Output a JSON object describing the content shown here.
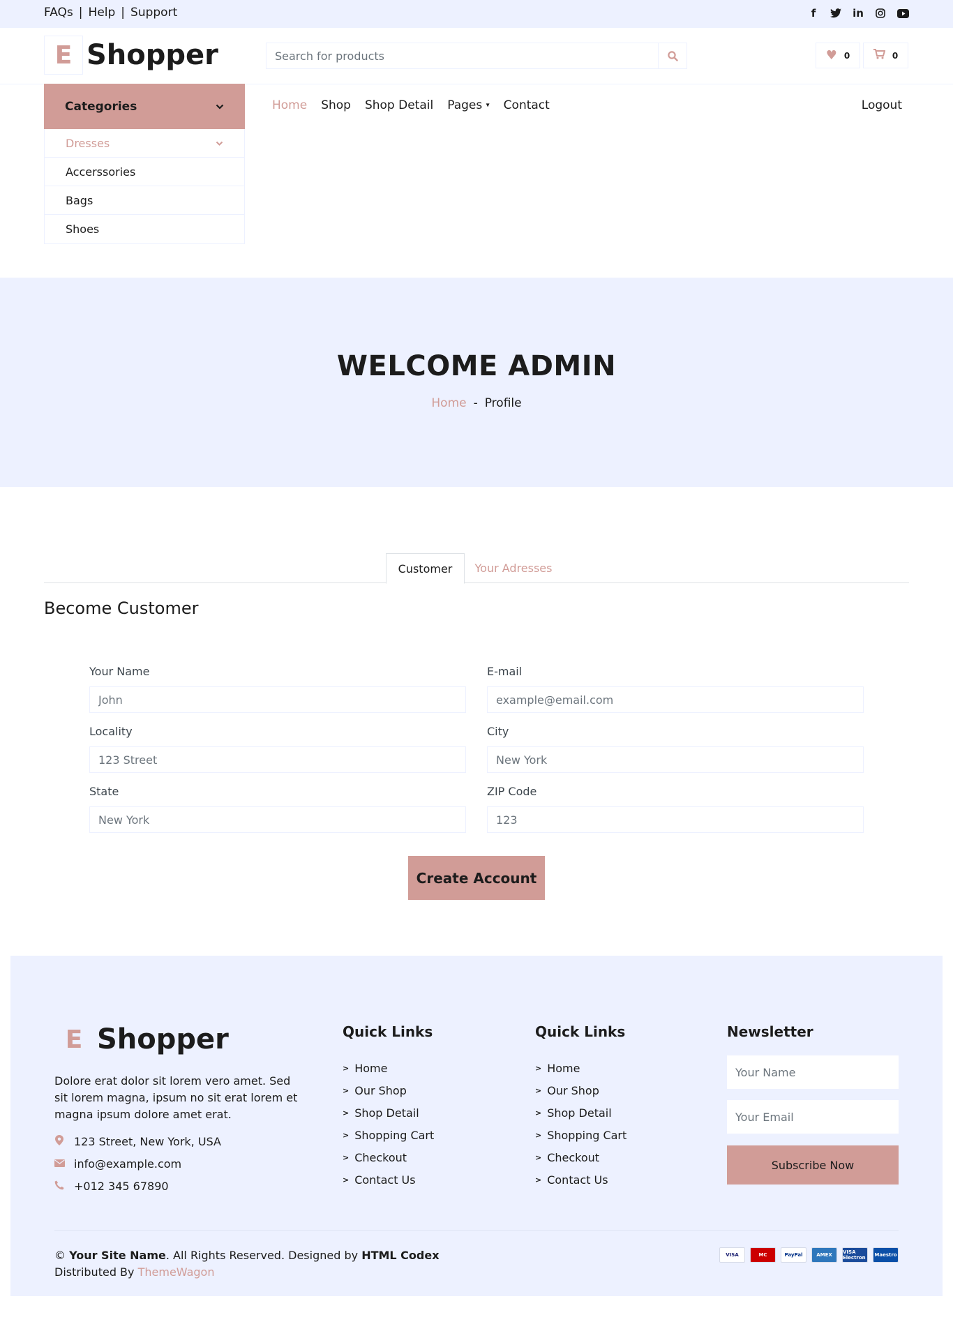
{
  "topbar": {
    "links": [
      "FAQs",
      "Help",
      "Support"
    ],
    "separator": "|",
    "socials": [
      "facebook-icon",
      "twitter-icon",
      "linkedin-icon",
      "instagram-icon",
      "youtube-icon"
    ]
  },
  "brand": {
    "letter": "E",
    "name": "Shopper"
  },
  "search": {
    "placeholder": "Search for products",
    "icon": "search-icon"
  },
  "header_buttons": {
    "wishlist_count": "0",
    "cart_count": "0"
  },
  "categories": {
    "title": "Categories",
    "items": [
      "Dresses",
      "Accerssories",
      "Bags",
      "Shoes"
    ]
  },
  "nav": {
    "items": [
      "Home",
      "Shop",
      "Shop Detail",
      "Pages",
      "Contact"
    ],
    "active": "Home",
    "logout": "Logout"
  },
  "hero": {
    "title": "WELCOME ADMIN",
    "crumb_home": "Home",
    "crumb_sep": "-",
    "crumb_current": "Profile"
  },
  "tabs": {
    "customer": "Customer",
    "addresses": "Your Adresses"
  },
  "section_title": "Become Customer",
  "form": {
    "name_label": "Your Name",
    "name_placeholder": "John",
    "email_label": "E-mail",
    "email_placeholder": "example@email.com",
    "locality_label": "Locality",
    "locality_placeholder": "123 Street",
    "city_label": "City",
    "city_placeholder": "New York",
    "state_label": "State",
    "state_placeholder": "New York",
    "zip_label": "ZIP Code",
    "zip_placeholder": "123",
    "submit": "Create Account"
  },
  "footer": {
    "description": "Dolore erat dolor sit lorem vero amet. Sed sit lorem magna, ipsum no sit erat lorem et magna ipsum dolore amet erat.",
    "address": "123 Street, New York, USA",
    "email": "info@example.com",
    "phone": "+012 345 67890",
    "quick_links_title": "Quick Links",
    "quick_links": [
      "Home",
      "Our Shop",
      "Shop Detail",
      "Shopping Cart",
      "Checkout",
      "Contact Us"
    ],
    "newsletter_title": "Newsletter",
    "nl_name_placeholder": "Your Name",
    "nl_email_placeholder": "Your Email",
    "subscribe": "Subscribe Now",
    "copy_symbol": "©",
    "site_name": "Your Site Name",
    "rights_text": ". All Rights Reserved. Designed by",
    "designer": "HTML Codex",
    "distributed_text": "Distributed By",
    "distributor": "ThemeWagon",
    "payments": [
      {
        "name": "VISA",
        "color": "#1a1f71",
        "bg": "#ffffff"
      },
      {
        "name": "MC",
        "color": "#ffffff",
        "bg": "#cc0000"
      },
      {
        "name": "PayPal",
        "color": "#003087",
        "bg": "#ffffff"
      },
      {
        "name": "AMEX",
        "color": "#ffffff",
        "bg": "#2e77bc"
      },
      {
        "name": "VISA Electron",
        "color": "#ffffff",
        "bg": "#1a4b9b"
      },
      {
        "name": "Maestro",
        "color": "#ffffff",
        "bg": "#0a4fa8"
      }
    ]
  },
  "colors": {
    "accent": "#d19c97",
    "light_bg": "#edf1ff",
    "dark_text": "#1c1c1c"
  }
}
